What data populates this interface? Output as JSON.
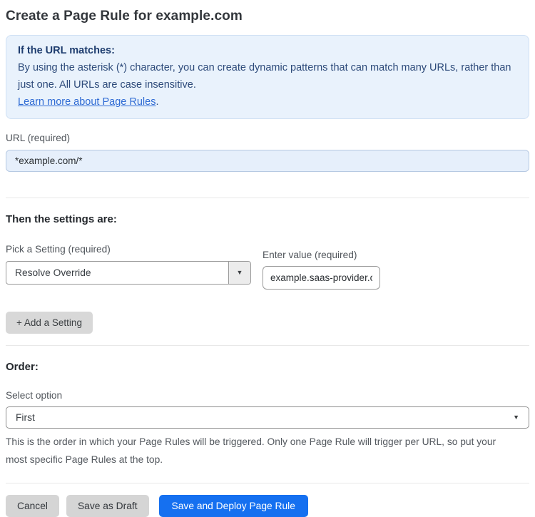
{
  "page": {
    "title": "Create a Page Rule for example.com"
  },
  "info_box": {
    "heading": "If the URL matches:",
    "body": "By using the asterisk (*) character, you can create dynamic patterns that can match many URLs, rather than just one. All URLs are case insensitive.",
    "link_text": "Learn more about Page Rules",
    "link_suffix": "."
  },
  "url_field": {
    "label": "URL (required)",
    "value": "*example.com/*"
  },
  "settings_section": {
    "heading": "Then the settings are:",
    "setting_label": "Pick a Setting (required)",
    "setting_selected": "Resolve Override",
    "value_label": "Enter value (required)",
    "value_value": "example.saas-provider.c",
    "add_button_label": "+ Add a Setting"
  },
  "order_section": {
    "heading": "Order:",
    "select_label": "Select option",
    "select_selected": "First",
    "help_text": "This is the order in which your Page Rules will be triggered. Only one Page Rule will trigger per URL, so put your most specific Page Rules at the top."
  },
  "footer": {
    "cancel_label": "Cancel",
    "save_draft_label": "Save as Draft",
    "save_deploy_label": "Save and Deploy Page Rule"
  },
  "icons": {
    "caret_down": "▼"
  },
  "colors": {
    "primary_blue": "#1570f0",
    "info_box_bg": "#e9f2fc",
    "info_box_text": "#2d4a7a",
    "link_blue": "#2f6bd4",
    "url_input_bg": "#e6effb"
  }
}
